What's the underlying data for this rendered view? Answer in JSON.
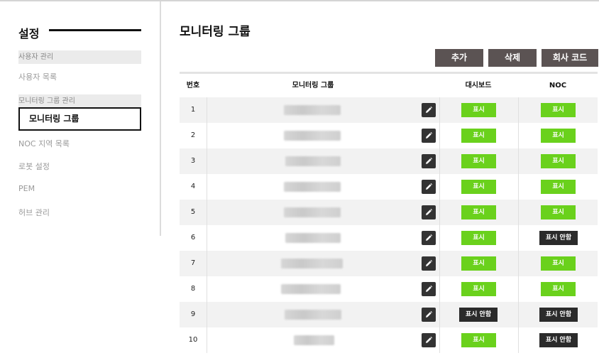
{
  "sidebar": {
    "title": "설정",
    "sections": [
      {
        "header": "사용자 관리",
        "items": [
          "사용자 목록"
        ]
      },
      {
        "header": "모니터링 그룹 관리",
        "items": [
          "모니터링 그룹"
        ]
      }
    ],
    "active_item": "모니터링 그룹",
    "other_items": [
      "NOC 지역 목록",
      "로봇 설정",
      "PEM",
      "허브 관리"
    ]
  },
  "main": {
    "title": "모니터링 그룹",
    "buttons": {
      "add": "추가",
      "delete": "삭제",
      "company_code": "회사 코드"
    },
    "columns": {
      "number": "번호",
      "group": "모니터링 그룹",
      "dashboard": "대시보드",
      "noc": "NOC"
    },
    "rows": [
      {
        "number": "1",
        "dashboard": "표시",
        "noc": "표시"
      },
      {
        "number": "2",
        "dashboard": "표시",
        "noc": "표시"
      },
      {
        "number": "3",
        "dashboard": "표시",
        "noc": "표시"
      },
      {
        "number": "4",
        "dashboard": "표시",
        "noc": "표시"
      },
      {
        "number": "5",
        "dashboard": "표시",
        "noc": "표시"
      },
      {
        "number": "6",
        "dashboard": "표시",
        "noc": "표시 안함"
      },
      {
        "number": "7",
        "dashboard": "표시",
        "noc": "표시"
      },
      {
        "number": "8",
        "dashboard": "표시",
        "noc": "표시"
      },
      {
        "number": "9",
        "dashboard": "표시 안함",
        "noc": "표시 안함"
      },
      {
        "number": "10",
        "dashboard": "표시",
        "noc": "표시 안함"
      }
    ]
  },
  "colors": {
    "button_bg": "#5b5353",
    "show_green": "#6ad11c",
    "hide_dark": "#2b2b2b",
    "edit_bg": "#333333"
  },
  "icons": {
    "edit": "pencil-icon"
  }
}
